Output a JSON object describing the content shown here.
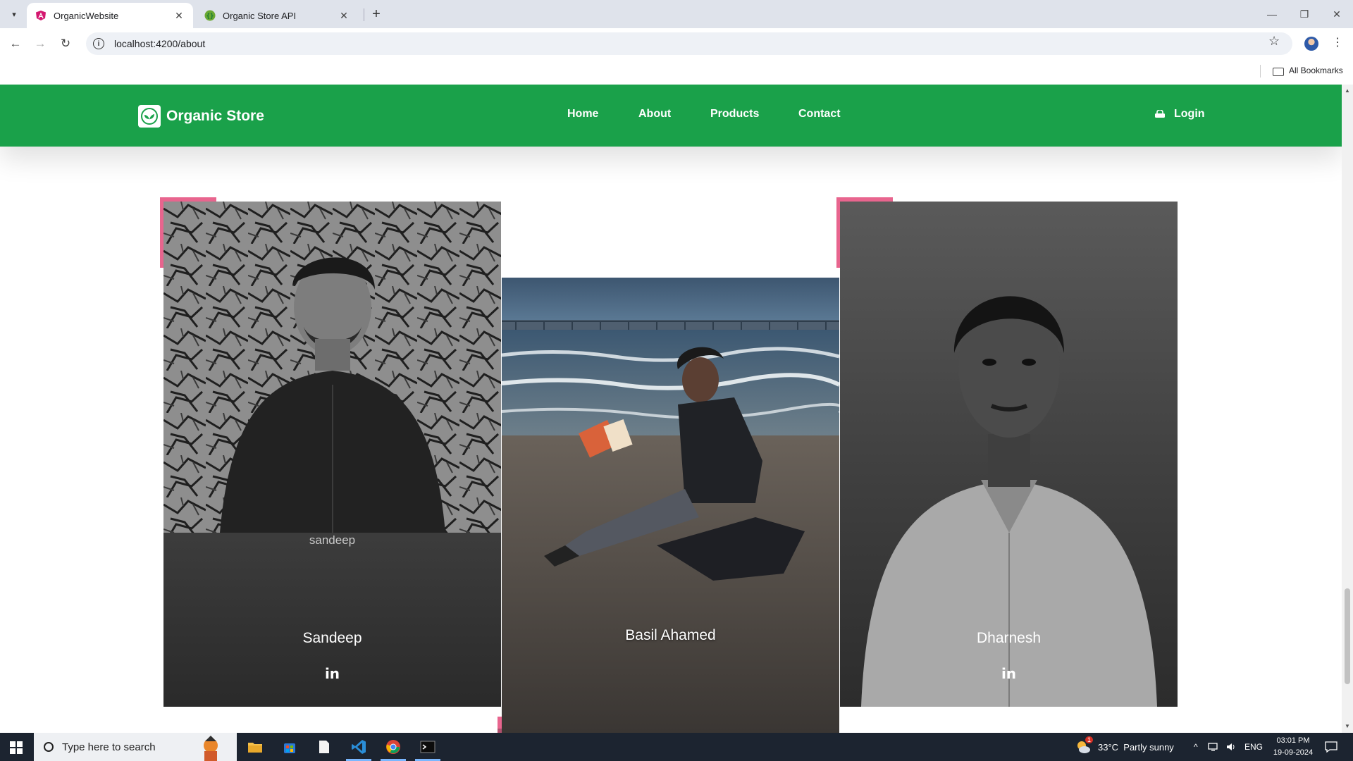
{
  "browser": {
    "tabs": [
      {
        "title": "OrganicWebsite",
        "active": true,
        "favicon": "angular-icon"
      },
      {
        "title": "Organic Store API",
        "active": false,
        "favicon": "swagger-icon"
      }
    ],
    "url": "localhost:4200/about",
    "bookmarks_label": "All Bookmarks"
  },
  "site": {
    "brand": "Organic Store",
    "nav": [
      "Home",
      "About",
      "Products",
      "Contact"
    ],
    "login": "Login",
    "accent_color": "#1aa14a"
  },
  "team": [
    {
      "name": "Sandeep",
      "img_alt": "sandeep",
      "social": "in"
    },
    {
      "name": "Basil Ahamed",
      "social": "in"
    },
    {
      "name": "Dharnesh",
      "social": "in"
    }
  ],
  "taskbar": {
    "search_placeholder": "Type here to search",
    "weather_badge": "1",
    "weather": "33°C  Partly sunny",
    "language": "ENG",
    "time": "03:01 PM",
    "date": "19-09-2024"
  }
}
